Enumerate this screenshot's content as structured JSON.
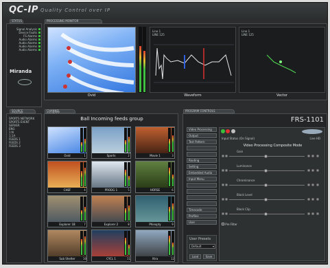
{
  "header": {
    "logo": "QC-IP",
    "tagline": "Quality Control over IP"
  },
  "tabs": {
    "status": "STATUS",
    "processing": "PROCESSING MONITOR",
    "source_groups": "SOURCE GROUPS",
    "channel_sources": "CHANNEL SOURCES",
    "program_controls": "PROGRAM CONTROLS"
  },
  "status_list": [
    "Signal Analysis",
    "Device Faults",
    "FS Alarms",
    "Audio Alarms",
    "Audio Alarms",
    "Audio Alarms",
    "Audio Alarms"
  ],
  "miranda": "Miranda",
  "monitor": {
    "caption_main": "Ovid",
    "caption_waveform": "Waveform",
    "caption_vector": "Vector",
    "wf_info": "Line 1\nLINE 125",
    "vec_info": "Line 1\nLINE 125"
  },
  "groups": [
    "SPORTS NETWORK",
    "SPORTS EVENT",
    "SERVER",
    "ENG",
    "1:N",
    "1:1A",
    "FEEDS 1",
    "FEEDS 2",
    "FEEDS 3"
  ],
  "feeds_title": "Ball Incoming feeds group",
  "thumbs": [
    {
      "label": "Ovid",
      "num": "1"
    },
    {
      "label": "Sports",
      "num": "2"
    },
    {
      "label": "Movie 1",
      "num": "3"
    },
    {
      "label": "CHEF",
      "num": "4"
    },
    {
      "label": "PRODG 1",
      "num": "5"
    },
    {
      "label": "HORSE",
      "num": "6"
    },
    {
      "label": "Explorer 1B",
      "num": "7"
    },
    {
      "label": "Explorer 2",
      "num": "8"
    },
    {
      "label": "Phiexpty",
      "num": "9"
    },
    {
      "label": "Sub Shelter",
      "num": "10"
    },
    {
      "label": "CYCL 1",
      "num": "11"
    },
    {
      "label": "Xtra",
      "num": "12"
    }
  ],
  "controls": {
    "model": "FRS-1101",
    "left_buttons": [
      "Video Processing",
      "Output",
      "Test Pattern",
      "",
      "",
      "Routing",
      "Setting",
      "Embedded Audio",
      "Input Menu",
      "",
      "",
      "",
      "",
      "Timecode",
      "Profiles",
      "User"
    ],
    "video_label": "Video Processing Composite Mode",
    "input_label": "Input Status (On Signal)",
    "input_val": "Live HD",
    "sliders": [
      "Gain",
      "Luminance",
      "Chrominance",
      "Black Level",
      "Black Clip"
    ],
    "pre_filter": "Pre Filter",
    "user_presets": "User Presets",
    "preset_val": "Default",
    "load": "Load",
    "save": "Save"
  }
}
